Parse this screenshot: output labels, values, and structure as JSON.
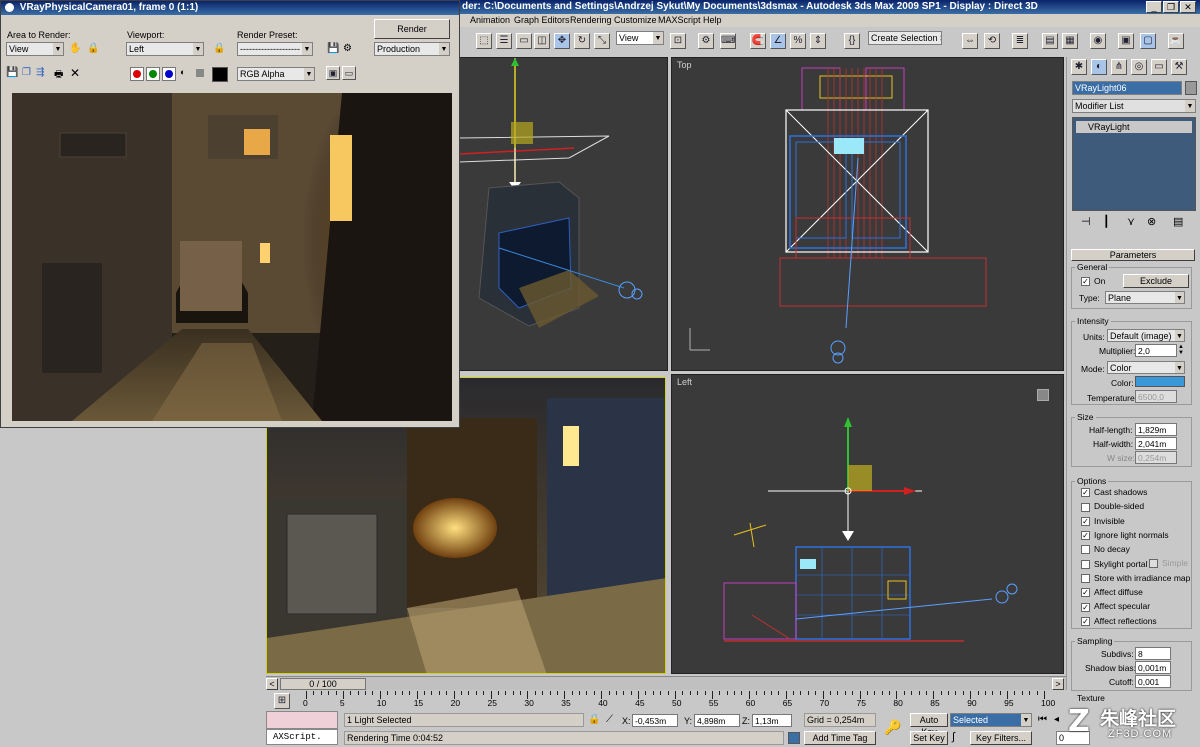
{
  "app_title": "der: C:\\Documents and Settings\\Andrzej Sykut\\My Documents\\3dsmax     - Autodesk 3ds Max  2009 SP1       - Display : Direct 3D",
  "menu": [
    "Animation",
    "Graph Editors",
    "Rendering",
    "Customize",
    "MAXScript",
    "Help"
  ],
  "toolbar": {
    "view_dropdown": "View",
    "selection_set": "Create Selection Se"
  },
  "vfb": {
    "title": "VRayPhysicalCamera01, frame 0 (1:1)",
    "area_label": "Area to Render:",
    "area_value": "View",
    "viewport_label": "Viewport:",
    "viewport_value": "Left",
    "preset_label": "Render Preset:",
    "preset_value": "--------------------",
    "render_button": "Render",
    "mode_value": "Production",
    "channel_value": "RGB Alpha"
  },
  "viewports": {
    "top_label": "Top",
    "left_label": "Left"
  },
  "command_panel": {
    "object_name": "VRayLight06",
    "modifier_list": "Modifier List",
    "stack_item": "VRayLight",
    "rollout_title": "Parameters",
    "general_label": "General",
    "on_label": "On",
    "exclude_button": "Exclude",
    "type_label": "Type:",
    "type_value": "Plane",
    "intensity_label": "Intensity",
    "units_label": "Units:",
    "units_value": "Default (image)",
    "multiplier_label": "Multiplier:",
    "multiplier_value": "2,0",
    "mode_label": "Mode:",
    "mode_value": "Color",
    "color_label": "Color:",
    "color_value": "#3a98d8",
    "temperature_label": "Temperature:",
    "temperature_value": "6500,0",
    "size_label": "Size",
    "half_length_label": "Half-length:",
    "half_length_value": "1,829m",
    "half_width_label": "Half-width:",
    "half_width_value": "2,041m",
    "w_size_label": "W size:",
    "w_size_value": "0,254m",
    "options_label": "Options",
    "options": [
      {
        "label": "Cast shadows",
        "checked": true
      },
      {
        "label": "Double-sided",
        "checked": false
      },
      {
        "label": "Invisible",
        "checked": true
      },
      {
        "label": "Ignore light normals",
        "checked": true
      },
      {
        "label": "No decay",
        "checked": false
      },
      {
        "label": "Skylight portal",
        "checked": false
      },
      {
        "label": "Store with irradiance map",
        "checked": false
      },
      {
        "label": "Affect diffuse",
        "checked": true
      },
      {
        "label": "Affect specular",
        "checked": true
      },
      {
        "label": "Affect reflections",
        "checked": true
      }
    ],
    "simple_label": "Simple",
    "sampling_label": "Sampling",
    "subdivs_label": "Subdivs:",
    "subdivs_value": "8",
    "shadow_bias_label": "Shadow bias:",
    "shadow_bias_value": "0,001m",
    "cutoff_label": "Cutoff:",
    "cutoff_value": "0,001",
    "texture_label": "Texture"
  },
  "timeline": {
    "frame_counter": "0 / 100",
    "ticks": [
      "0",
      "5",
      "10",
      "15",
      "20",
      "25",
      "30",
      "35",
      "40",
      "45",
      "50",
      "55",
      "60",
      "65",
      "70",
      "75",
      "80",
      "85",
      "90",
      "95",
      "100"
    ]
  },
  "status": {
    "maxscript": "AXScript.",
    "selection": "1 Light Selected",
    "render_time": "Rendering Time  0:04:52",
    "x_label": "X:",
    "x_value": "-0,453m",
    "y_label": "Y:",
    "y_value": "4,898m",
    "z_label": "Z:",
    "z_value": "1,13m",
    "grid": "Grid = 0,254m",
    "add_time_tag": "Add Time Tag",
    "auto_key": "Auto Key",
    "selected_dropdown": "Selected",
    "set_key": "Set Key",
    "key_filters": "Key Filters...",
    "frame_field": "0"
  },
  "watermark": {
    "cn": "朱峰社区",
    "en": "ZF3D.COM"
  }
}
